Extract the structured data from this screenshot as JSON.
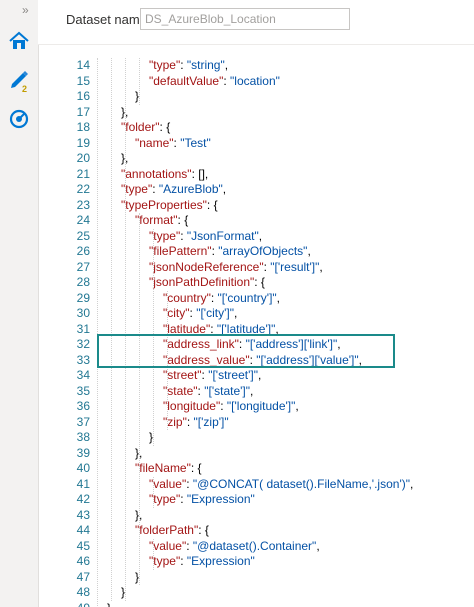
{
  "sidebar": {
    "collapse_glyph": "»",
    "items": [
      {
        "name": "home-icon"
      },
      {
        "name": "pencil-icon",
        "badge": "2"
      },
      {
        "name": "monitor-gauge-icon"
      }
    ]
  },
  "header": {
    "label": "Dataset name",
    "input_value": "DS_AzureBlob_Location"
  },
  "editor": {
    "lines": [
      {
        "n": "14",
        "indent": 6,
        "t": [
          [
            "k",
            "\"type\""
          ],
          [
            "p",
            ": "
          ],
          [
            "s",
            "\"string\""
          ],
          [
            "p",
            ","
          ]
        ]
      },
      {
        "n": "15",
        "indent": 6,
        "t": [
          [
            "k",
            "\"defaultValue\""
          ],
          [
            "p",
            ": "
          ],
          [
            "s",
            "\"location\""
          ]
        ]
      },
      {
        "n": "16",
        "indent": 5,
        "t": [
          [
            "p",
            "}"
          ]
        ]
      },
      {
        "n": "17",
        "indent": 4,
        "t": [
          [
            "p",
            "},"
          ]
        ]
      },
      {
        "n": "18",
        "indent": 4,
        "t": [
          [
            "k",
            "\"folder\""
          ],
          [
            "p",
            ": {"
          ]
        ]
      },
      {
        "n": "19",
        "indent": 5,
        "t": [
          [
            "k",
            "\"name\""
          ],
          [
            "p",
            ": "
          ],
          [
            "s",
            "\"Test\""
          ]
        ]
      },
      {
        "n": "20",
        "indent": 4,
        "t": [
          [
            "p",
            "},"
          ]
        ]
      },
      {
        "n": "21",
        "indent": 4,
        "t": [
          [
            "k",
            "\"annotations\""
          ],
          [
            "p",
            ": [],"
          ]
        ]
      },
      {
        "n": "22",
        "indent": 4,
        "t": [
          [
            "k",
            "\"type\""
          ],
          [
            "p",
            ": "
          ],
          [
            "s",
            "\"AzureBlob\""
          ],
          [
            "p",
            ","
          ]
        ]
      },
      {
        "n": "23",
        "indent": 4,
        "t": [
          [
            "k",
            "\"typeProperties\""
          ],
          [
            "p",
            ": {"
          ]
        ]
      },
      {
        "n": "24",
        "indent": 5,
        "t": [
          [
            "k",
            "\"format\""
          ],
          [
            "p",
            ": {"
          ]
        ]
      },
      {
        "n": "25",
        "indent": 6,
        "t": [
          [
            "k",
            "\"type\""
          ],
          [
            "p",
            ": "
          ],
          [
            "s",
            "\"JsonFormat\""
          ],
          [
            "p",
            ","
          ]
        ]
      },
      {
        "n": "26",
        "indent": 6,
        "t": [
          [
            "k",
            "\"filePattern\""
          ],
          [
            "p",
            ": "
          ],
          [
            "s",
            "\"arrayOfObjects\""
          ],
          [
            "p",
            ","
          ]
        ]
      },
      {
        "n": "27",
        "indent": 6,
        "t": [
          [
            "k",
            "\"jsonNodeReference\""
          ],
          [
            "p",
            ": "
          ],
          [
            "s",
            "\"['result']\""
          ],
          [
            "p",
            ","
          ]
        ]
      },
      {
        "n": "28",
        "indent": 6,
        "t": [
          [
            "k",
            "\"jsonPathDefinition\""
          ],
          [
            "p",
            ": {"
          ]
        ]
      },
      {
        "n": "29",
        "indent": 7,
        "t": [
          [
            "k",
            "\"country\""
          ],
          [
            "p",
            ": "
          ],
          [
            "s",
            "\"['country']\""
          ],
          [
            "p",
            ","
          ]
        ]
      },
      {
        "n": "30",
        "indent": 7,
        "t": [
          [
            "k",
            "\"city\""
          ],
          [
            "p",
            ": "
          ],
          [
            "s",
            "\"['city']\""
          ],
          [
            "p",
            ","
          ]
        ]
      },
      {
        "n": "31",
        "indent": 7,
        "t": [
          [
            "k",
            "\"latitude\""
          ],
          [
            "p",
            ": "
          ],
          [
            "s",
            "\"['latitude']\""
          ],
          [
            "p",
            ","
          ]
        ]
      },
      {
        "n": "32",
        "indent": 7,
        "t": [
          [
            "k",
            "\"address_link\""
          ],
          [
            "p",
            ": "
          ],
          [
            "s",
            "\"['address']['link']\""
          ],
          [
            "p",
            ","
          ]
        ]
      },
      {
        "n": "33",
        "indent": 7,
        "t": [
          [
            "k",
            "\"address_value\""
          ],
          [
            "p",
            ": "
          ],
          [
            "s",
            "\"['address']['value']\""
          ],
          [
            "p",
            ","
          ]
        ]
      },
      {
        "n": "34",
        "indent": 7,
        "t": [
          [
            "k",
            "\"street\""
          ],
          [
            "p",
            ": "
          ],
          [
            "s",
            "\"['street']\""
          ],
          [
            "p",
            ","
          ]
        ]
      },
      {
        "n": "35",
        "indent": 7,
        "t": [
          [
            "k",
            "\"state\""
          ],
          [
            "p",
            ": "
          ],
          [
            "s",
            "\"['state']\""
          ],
          [
            "p",
            ","
          ]
        ]
      },
      {
        "n": "36",
        "indent": 7,
        "t": [
          [
            "k",
            "\"longitude\""
          ],
          [
            "p",
            ": "
          ],
          [
            "s",
            "\"['longitude']\""
          ],
          [
            "p",
            ","
          ]
        ]
      },
      {
        "n": "37",
        "indent": 7,
        "t": [
          [
            "k",
            "\"zip\""
          ],
          [
            "p",
            ": "
          ],
          [
            "s",
            "\"['zip']\""
          ]
        ]
      },
      {
        "n": "38",
        "indent": 6,
        "t": [
          [
            "p",
            "}"
          ]
        ]
      },
      {
        "n": "39",
        "indent": 5,
        "t": [
          [
            "p",
            "},"
          ]
        ]
      },
      {
        "n": "40",
        "indent": 5,
        "t": [
          [
            "k",
            "\"fileName\""
          ],
          [
            "p",
            ": {"
          ]
        ]
      },
      {
        "n": "41",
        "indent": 6,
        "t": [
          [
            "k",
            "\"value\""
          ],
          [
            "p",
            ": "
          ],
          [
            "s",
            "\"@CONCAT( dataset().FileName,'.json')\""
          ],
          [
            "p",
            ","
          ]
        ]
      },
      {
        "n": "42",
        "indent": 6,
        "t": [
          [
            "k",
            "\"type\""
          ],
          [
            "p",
            ": "
          ],
          [
            "s",
            "\"Expression\""
          ]
        ]
      },
      {
        "n": "43",
        "indent": 5,
        "t": [
          [
            "p",
            "},"
          ]
        ]
      },
      {
        "n": "44",
        "indent": 5,
        "t": [
          [
            "k",
            "\"folderPath\""
          ],
          [
            "p",
            ": {"
          ]
        ]
      },
      {
        "n": "45",
        "indent": 6,
        "t": [
          [
            "k",
            "\"value\""
          ],
          [
            "p",
            ": "
          ],
          [
            "s",
            "\"@dataset().Container\""
          ],
          [
            "p",
            ","
          ]
        ]
      },
      {
        "n": "46",
        "indent": 6,
        "t": [
          [
            "k",
            "\"type\""
          ],
          [
            "p",
            ": "
          ],
          [
            "s",
            "\"Expression\""
          ]
        ]
      },
      {
        "n": "47",
        "indent": 5,
        "t": [
          [
            "p",
            "}"
          ]
        ]
      },
      {
        "n": "48",
        "indent": 4,
        "t": [
          [
            "p",
            "}"
          ]
        ]
      },
      {
        "n": "49",
        "indent": 3,
        "t": [
          [
            "p",
            "}"
          ]
        ]
      }
    ]
  }
}
